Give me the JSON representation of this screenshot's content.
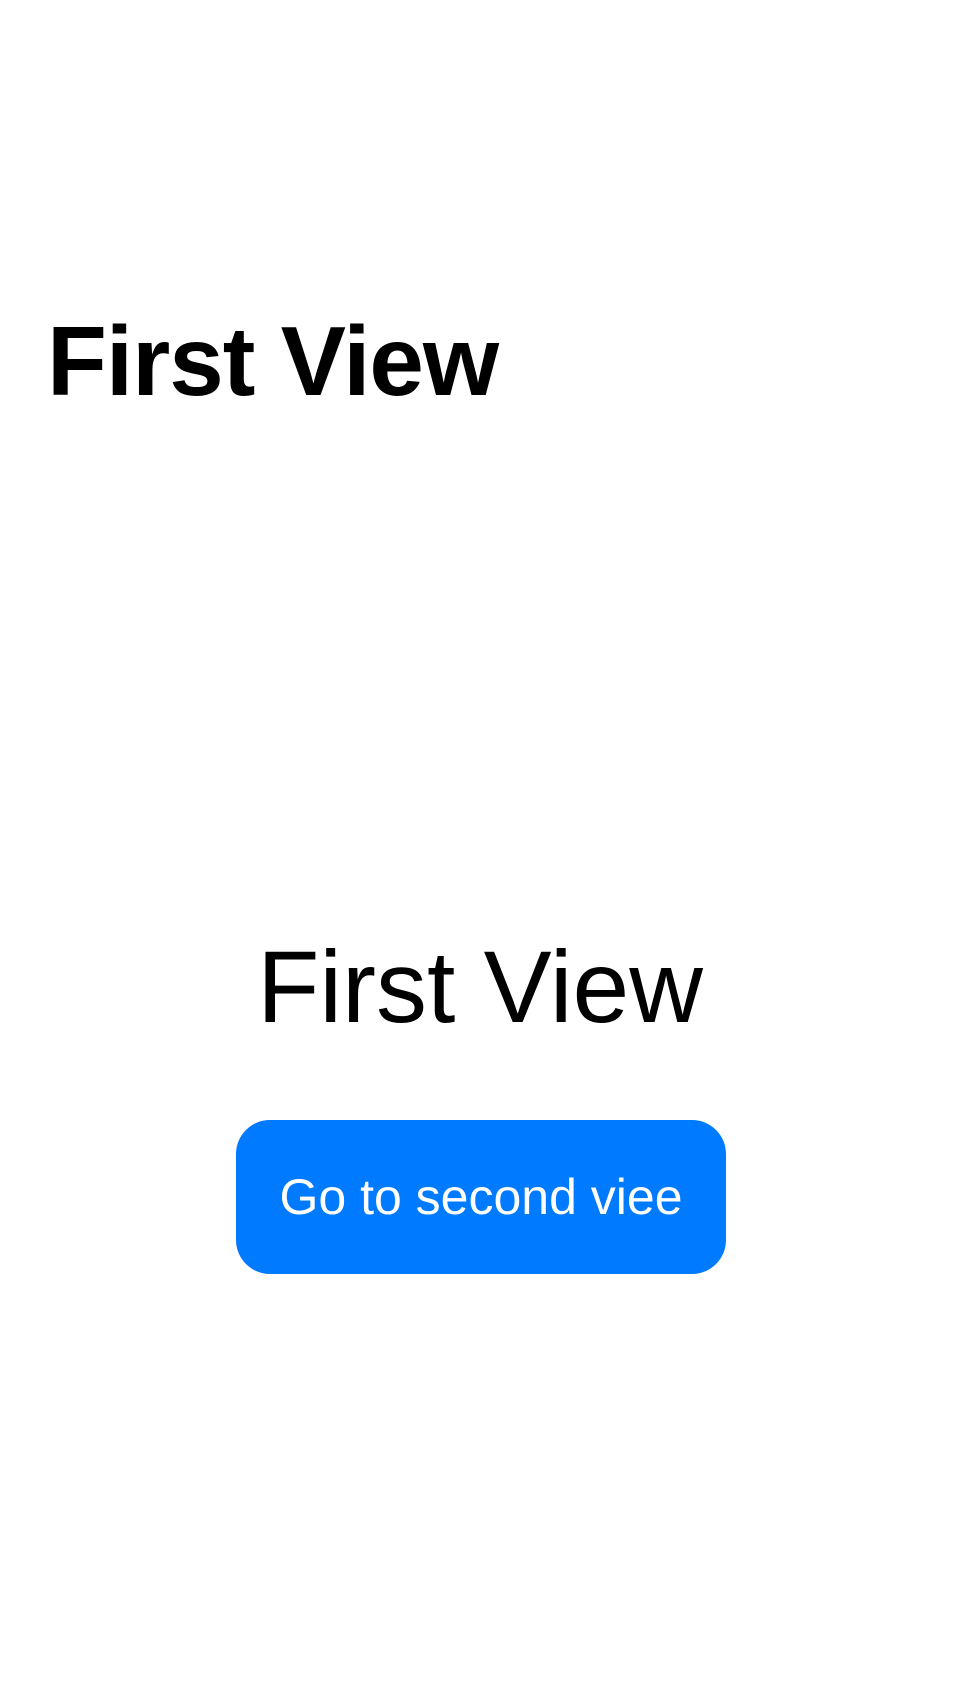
{
  "nav": {
    "title": "First View"
  },
  "content": {
    "title": "First View",
    "button_label": "Go to second viee"
  },
  "colors": {
    "background": "#FFFFFF",
    "text": "#000000",
    "button_background": "#007AFF",
    "button_text": "#FFFFFF"
  }
}
